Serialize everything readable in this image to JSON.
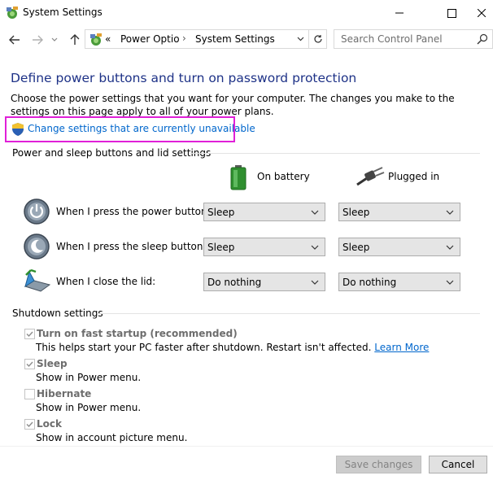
{
  "window": {
    "title": "System Settings"
  },
  "address": {
    "overflow": "«",
    "crumbs": [
      "Power Optio",
      "System Settings"
    ]
  },
  "search": {
    "placeholder": "Search Control Panel"
  },
  "page": {
    "heading": "Define power buttons and turn on password protection",
    "description": "Choose the power settings that you want for your computer. The changes you make to the settings on this page apply to all of your power plans.",
    "change_link": "Change settings that are currently unavailable"
  },
  "power_section": {
    "label": "Power and sleep buttons and lid settings",
    "columns": {
      "battery": "On battery",
      "plugged": "Plugged in"
    },
    "rows": [
      {
        "label": "When I press the power button:",
        "battery": "Sleep",
        "plugged": "Sleep",
        "icon": "power-button-icon"
      },
      {
        "label": "When I press the sleep button:",
        "battery": "Sleep",
        "plugged": "Sleep",
        "icon": "sleep-button-icon"
      },
      {
        "label": "When I close the lid:",
        "battery": "Do nothing",
        "plugged": "Do nothing",
        "icon": "laptop-lid-icon"
      }
    ]
  },
  "shutdown_section": {
    "label": "Shutdown settings",
    "items": [
      {
        "label": "Turn on fast startup (recommended)",
        "checked": true,
        "desc": "This helps start your PC faster after shutdown. Restart isn't affected.",
        "link": "Learn More"
      },
      {
        "label": "Sleep",
        "checked": true,
        "desc": "Show in Power menu."
      },
      {
        "label": "Hibernate",
        "checked": false,
        "desc": "Show in Power menu."
      },
      {
        "label": "Lock",
        "checked": true,
        "desc": "Show in account picture menu."
      }
    ]
  },
  "footer": {
    "save_label": "Save changes",
    "cancel_label": "Cancel"
  },
  "colors": {
    "heading": "#1e3287",
    "link": "#0066cc",
    "highlight": "#e020d8"
  }
}
